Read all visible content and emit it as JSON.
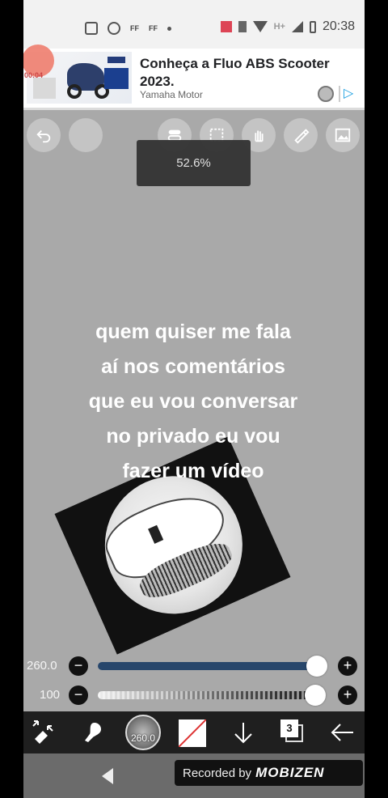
{
  "status_bar": {
    "clock": "20:38",
    "icons": [
      "news-icon",
      "whatsapp-icon",
      "ff-icon",
      "ff-icon",
      "dot-icon",
      "cast-icon",
      "vibrate-icon",
      "wifi-icon",
      "hplus-signal-icon",
      "signal-icon",
      "battery-icon"
    ],
    "ff_label_1": "FF",
    "ff_label_2": "FF",
    "network_label": "H+"
  },
  "ad": {
    "title": "Conheça a Fluo ABS Scooter 2023.",
    "advertiser": "Yamaha Motor",
    "recording_time": "00:04",
    "adchoices_icon": "▷"
  },
  "canvas_tools": {
    "undo_icon": "undo-icon",
    "redo_icon": "circle-icon",
    "toggle_icon": "toggle-icon",
    "select_icon": "selection-icon",
    "hand_icon": "hand-icon",
    "pen_icon": "pen-icon",
    "image_icon": "image-icon"
  },
  "zoom": {
    "label": "52.6%"
  },
  "caption": {
    "lines": [
      "quem quiser me fala",
      "aí nos comentários",
      "que eu vou conversar",
      "no privado eu vou",
      "fazer um vídeo"
    ]
  },
  "sliders": {
    "size": {
      "value": "260.0",
      "level": 0.96,
      "minus": "−",
      "plus": "+"
    },
    "opacity": {
      "value": "100",
      "level": 1.0,
      "minus": "−",
      "plus": "+"
    }
  },
  "toolbar": {
    "brush_size": "260.0",
    "layer_count": "3",
    "icons": [
      "transform-eraser-icon",
      "dropper-icon",
      "brush-preview",
      "color-swatch",
      "arrow-down-icon",
      "layers-icon",
      "back-arrow-icon"
    ]
  },
  "navbar": {
    "recorded_label": "Recorded by",
    "recorder_brand": "MOBIZEN"
  },
  "colors": {
    "canvas_bg": "#a9a9a9",
    "slider_fill": "#27466b",
    "toolbar_bg": "#1f1f1f"
  }
}
